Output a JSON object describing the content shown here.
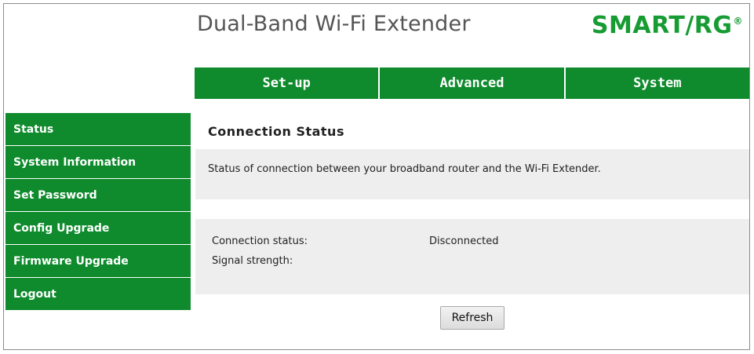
{
  "header": {
    "title": "Dual-Band Wi-Fi Extender",
    "brand": "SMART/RG",
    "brand_mark": "®",
    "brand_color": "#179c33"
  },
  "topnav": {
    "tabs": [
      {
        "label": "Set-up"
      },
      {
        "label": "Advanced"
      },
      {
        "label": "System"
      }
    ],
    "color": "#0f8b2d"
  },
  "sidebar": {
    "items": [
      {
        "label": "Status"
      },
      {
        "label": "System Information"
      },
      {
        "label": "Set Password"
      },
      {
        "label": "Config Upgrade"
      },
      {
        "label": "Firmware Upgrade"
      },
      {
        "label": "Logout"
      }
    ]
  },
  "main": {
    "title": "Connection Status",
    "description": "Status of connection between your broadband router and the Wi-Fi Extender.",
    "status": {
      "connection_label": "Connection status:",
      "connection_value": "Disconnected",
      "signal_label": "Signal strength:",
      "signal_value": ""
    },
    "refresh_label": "Refresh"
  }
}
